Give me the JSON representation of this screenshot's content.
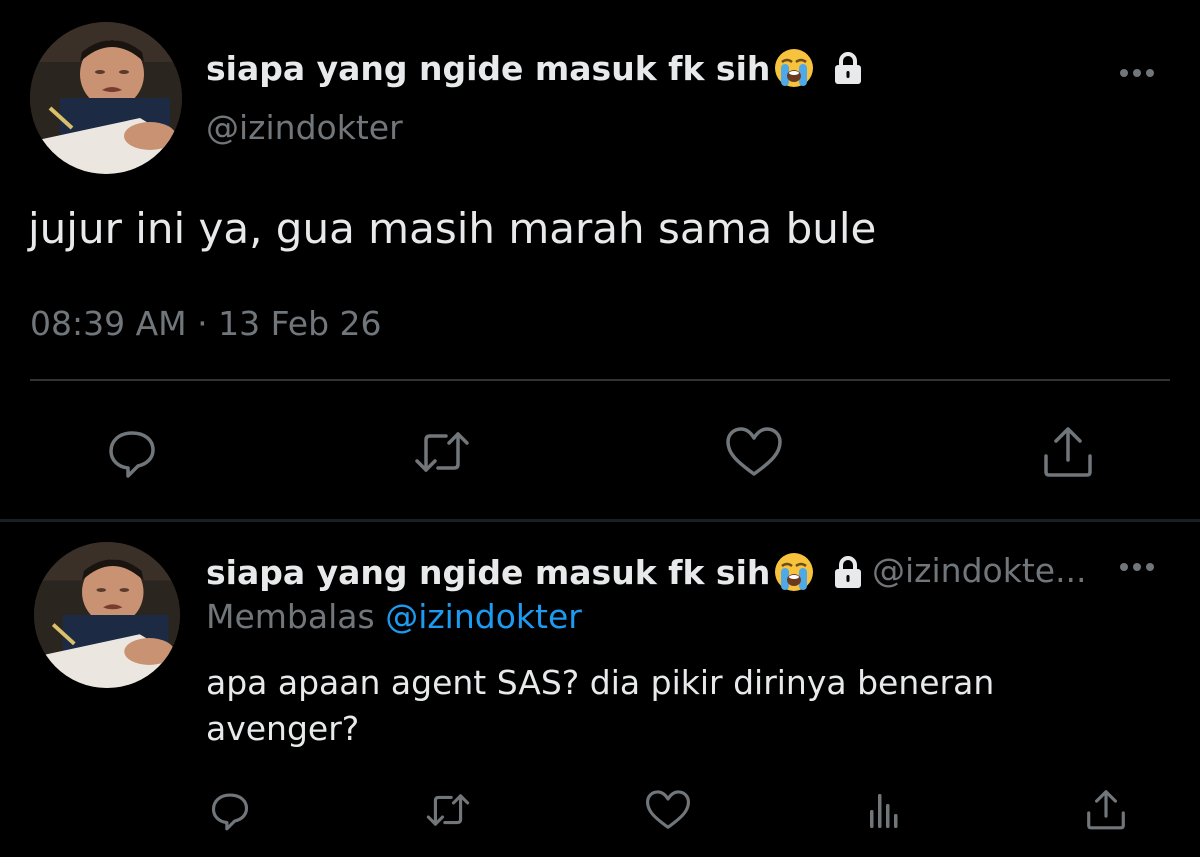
{
  "main_tweet": {
    "author": {
      "display_name": "siapa yang ngide masuk fk sih",
      "name_emoji": "loudly-crying-face-emoji",
      "handle": "@izindokter",
      "protected_icon": "lock-icon"
    },
    "text": "jujur ini ya, gua masih marah sama bule",
    "timestamp": "08:39 AM · 13 Feb 26",
    "actions": [
      "reply-icon",
      "retweet-icon",
      "like-icon",
      "share-icon"
    ]
  },
  "reply_tweet": {
    "author": {
      "display_name": "siapa yang ngide masuk fk sih",
      "name_emoji": "loudly-crying-face-emoji",
      "handle": "@izindokte...",
      "protected_icon": "lock-icon"
    },
    "replying_label": "Membalas",
    "replying_to": "@izindokter",
    "text": "apa apaan agent SAS? dia pikir dirinya beneran avenger?",
    "actions": [
      "reply-icon",
      "retweet-icon",
      "like-icon",
      "analytics-icon",
      "share-icon"
    ]
  },
  "colors": {
    "background": "#000000",
    "text": "#e7e9ea",
    "secondary": "#71767b",
    "link": "#1d9bf0",
    "divider": "#2f3336"
  }
}
